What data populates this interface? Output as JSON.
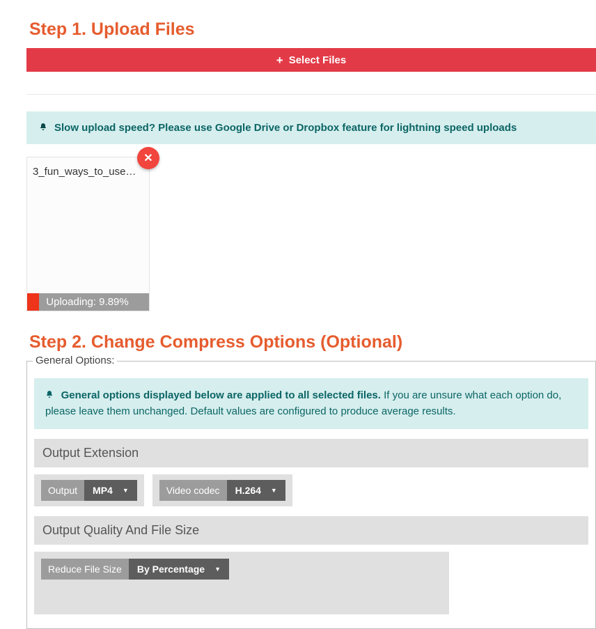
{
  "step1": {
    "heading": "Step 1. Upload Files",
    "select_button_label": "Select Files"
  },
  "upload_hint": {
    "text": "Slow upload speed? Please use Google Drive or Dropbox feature for lightning speed uploads"
  },
  "upload_card": {
    "filename": "3_fun_ways_to_use…",
    "progress_percent": 9.89,
    "progress_label": "Uploading: 9.89%"
  },
  "step2": {
    "heading": "Step 2. Change Compress Options (Optional)",
    "fieldset_legend": "General Options:",
    "info_strong": "General options displayed below are applied to all selected files.",
    "info_rest": " If you are unsure what each option do, please leave them unchanged. Default values are configured to produce average results.",
    "output_extension_header": "Output Extension",
    "output_label": "Output",
    "output_value": "MP4",
    "codec_label": "Video codec",
    "codec_value": "H.264",
    "quality_header": "Output Quality And File Size",
    "reduce_label": "Reduce File Size",
    "reduce_value": "By Percentage"
  }
}
